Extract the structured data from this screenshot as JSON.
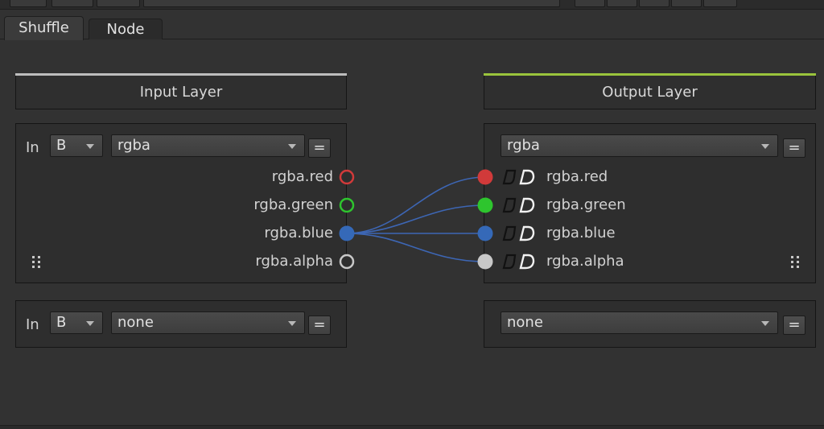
{
  "tabs": [
    {
      "label": "Shuffle",
      "active": true
    },
    {
      "label": "Node",
      "active": false
    }
  ],
  "input_header": {
    "title": "Input Layer",
    "accent": "#bdbdbd"
  },
  "output_header": {
    "title": "Output Layer",
    "accent": "#9ac43c"
  },
  "input1": {
    "in_label": "In",
    "source": "B",
    "layer": "rgba",
    "eq_label": "=",
    "channels": [
      "rgba.red",
      "rgba.green",
      "rgba.blue",
      "rgba.alpha"
    ]
  },
  "output1": {
    "layer": "rgba",
    "eq_label": "=",
    "channels": [
      "rgba.red",
      "rgba.green",
      "rgba.blue",
      "rgba.alpha"
    ]
  },
  "input2": {
    "in_label": "In",
    "source": "B",
    "layer": "none",
    "eq_label": "="
  },
  "output2": {
    "layer": "none",
    "eq_label": "="
  },
  "colors": {
    "red": "#d13a3a",
    "green": "#2ec52e",
    "blue": "#3569b8",
    "alpha": "#c8c8c8",
    "wire": "#3d66b4"
  },
  "wiring": {
    "source_channel": "rgba.blue",
    "targets": [
      "rgba.red",
      "rgba.green",
      "rgba.blue",
      "rgba.alpha"
    ]
  }
}
